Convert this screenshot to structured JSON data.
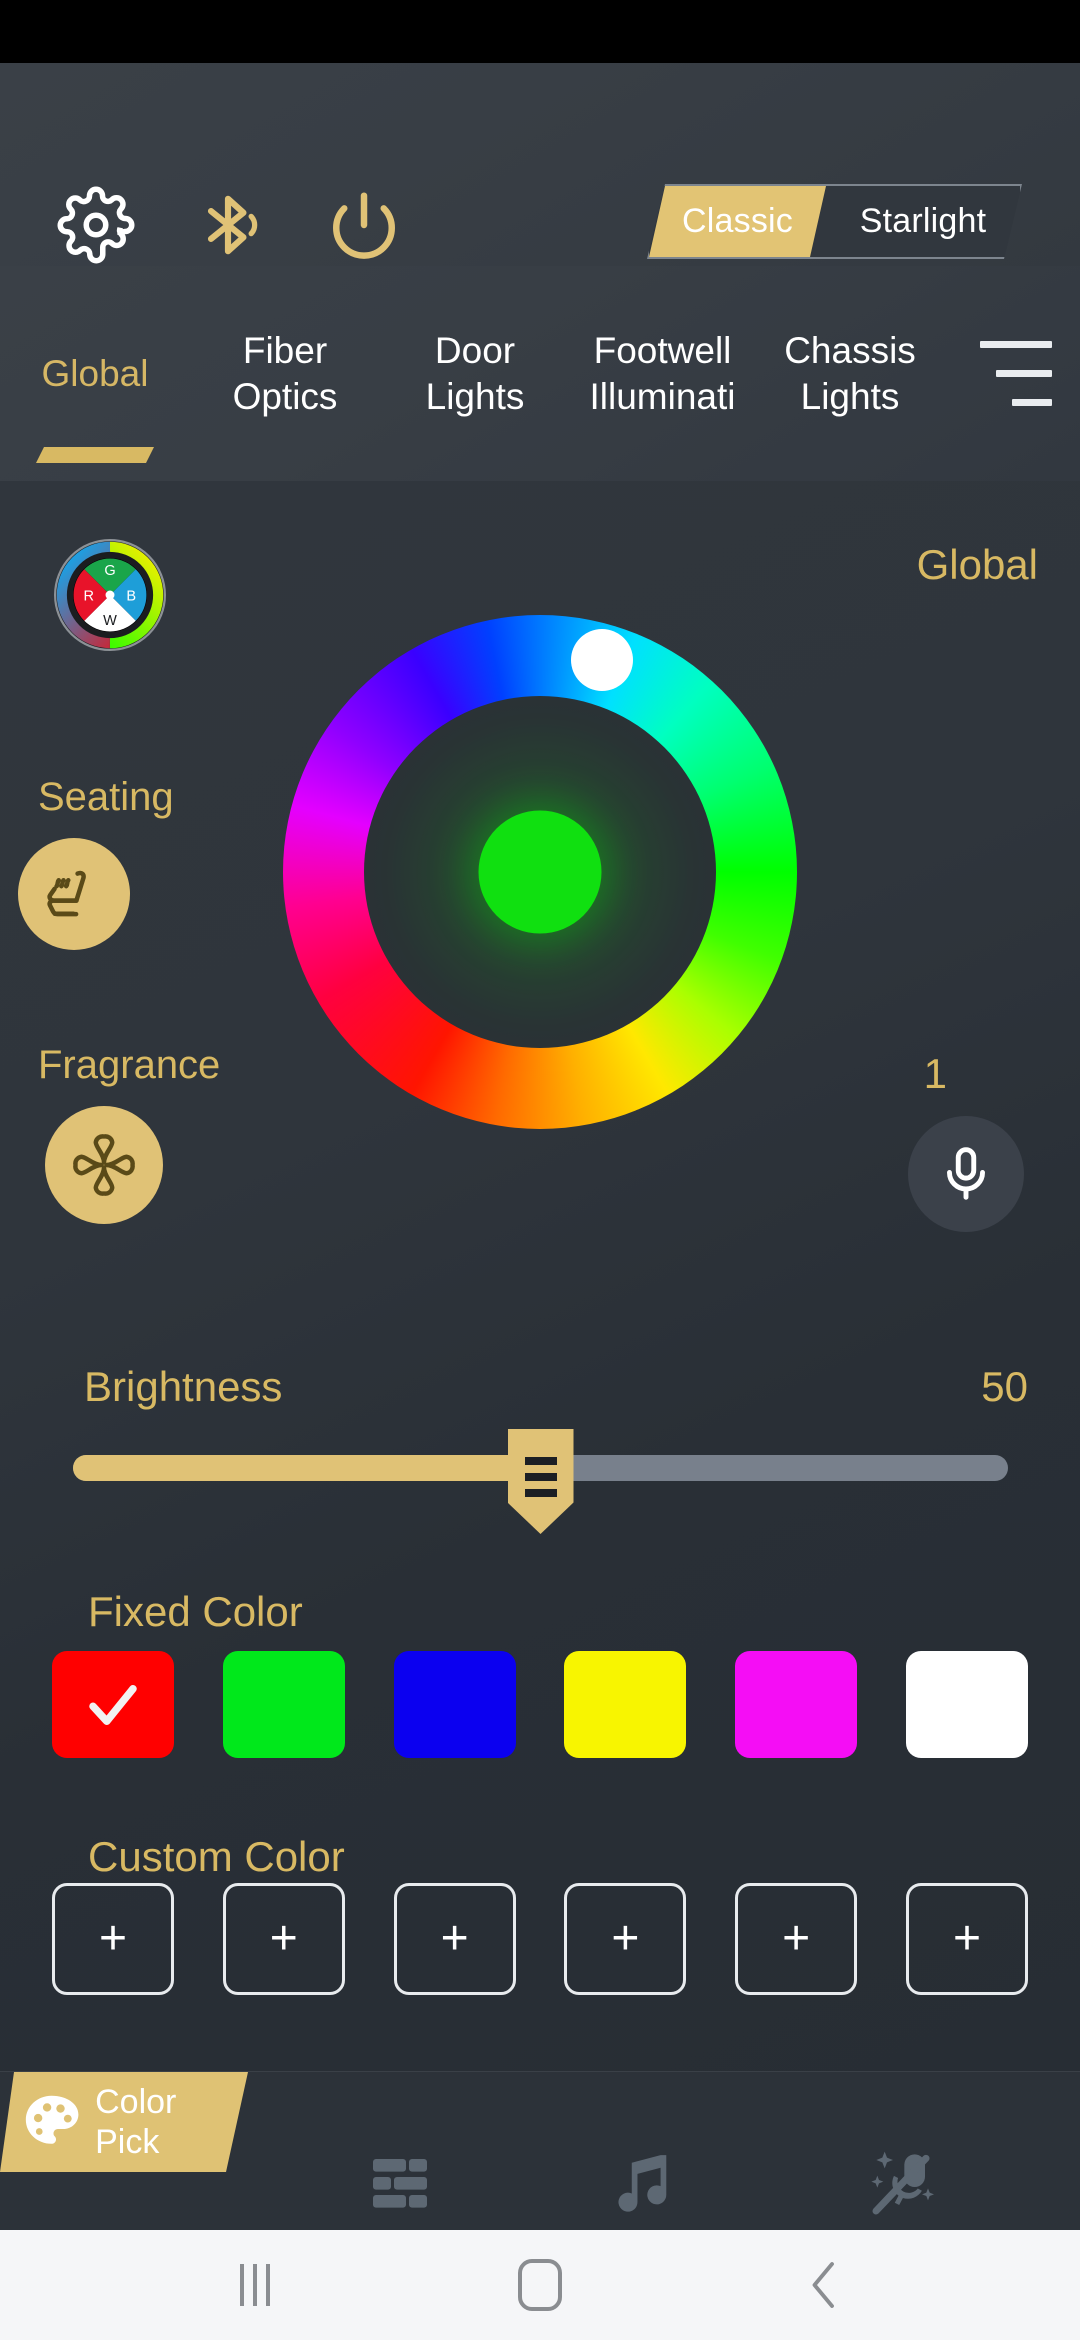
{
  "statusbar": {
    "background": "#000000"
  },
  "toolbar": {
    "icons": [
      {
        "name": "gear-icon",
        "label": "Settings"
      },
      {
        "name": "bluetooth-icon",
        "label": "Bluetooth"
      },
      {
        "name": "power-icon",
        "label": "Power"
      }
    ],
    "mode_toggle": {
      "selected": "Classic",
      "options": [
        "Classic",
        "Starlight"
      ],
      "classic_label": "Classic",
      "starlight_label": "Starlight",
      "active_color": "#e2c474"
    }
  },
  "tabs": {
    "active": "Global",
    "items": [
      {
        "label": "Global",
        "line1": "Global",
        "line2": ""
      },
      {
        "label": "Fiber Optics",
        "line1": "Fiber",
        "line2": "Optics"
      },
      {
        "label": "Door Lights",
        "line1": "Door",
        "line2": "Lights"
      },
      {
        "label": "Footwell Illuminati",
        "line1": "Footwell",
        "line2": "Illuminati"
      },
      {
        "label": "Chassis Lights",
        "line1": "Chassis",
        "line2": "Lights"
      }
    ],
    "menu_icon": "hamburger-menu-icon"
  },
  "content": {
    "zone_label": "Global",
    "rgbw_icon": {
      "name": "rgbw-color-wheel-icon",
      "segments": [
        "R",
        "G",
        "B",
        "W"
      ]
    },
    "color_wheel": {
      "name": "hue-color-wheel",
      "selected_color": "#10e010",
      "handle_position_deg": 80
    },
    "seating": {
      "label": "Seating",
      "icon": "heated-seat-icon",
      "color": "#e0c276"
    },
    "fragrance": {
      "label": "Fragrance",
      "icon": "clover-fragrance-icon",
      "color": "#e0c276"
    },
    "voice": {
      "count": "1",
      "icon": "microphone-icon"
    },
    "brightness": {
      "label": "Brightness",
      "value": "50",
      "percent": 50,
      "min": 0,
      "max": 100
    },
    "fixed_color": {
      "title": "Fixed Color",
      "selected_index": 0,
      "swatches": [
        {
          "name": "red",
          "hex": "#ff0000",
          "selected": true
        },
        {
          "name": "green",
          "hex": "#00e81b",
          "selected": false
        },
        {
          "name": "blue",
          "hex": "#0b00f0",
          "selected": false
        },
        {
          "name": "yellow",
          "hex": "#f8f500",
          "selected": false
        },
        {
          "name": "magenta",
          "hex": "#f50df5",
          "selected": false
        },
        {
          "name": "white",
          "hex": "#ffffff",
          "selected": false
        }
      ]
    },
    "custom_color": {
      "title": "Custom Color",
      "slots": [
        {
          "label": "+",
          "filled": false
        },
        {
          "label": "+",
          "filled": false
        },
        {
          "label": "+",
          "filled": false
        },
        {
          "label": "+",
          "filled": false
        },
        {
          "label": "+",
          "filled": false
        },
        {
          "label": "+",
          "filled": false
        }
      ]
    }
  },
  "bottom_nav": {
    "active": "Color Pick",
    "items": [
      {
        "label": "Color Pick",
        "line1": "Color",
        "line2": "Pick",
        "icon": "palette-icon",
        "active": true
      },
      {
        "label": "",
        "icon": "effects-sliders-icon",
        "active": false
      },
      {
        "label": "",
        "icon": "music-note-icon",
        "active": false
      },
      {
        "label": "",
        "icon": "voice-sparkle-icon",
        "active": false
      }
    ]
  },
  "android_nav": {
    "recents": "recents-icon",
    "home": "home-icon",
    "back": "back-icon"
  },
  "colors": {
    "gold": "#d8b963",
    "gold_fill": "#e0c276",
    "panel": "#2f353c",
    "toolbar": "#383e45"
  }
}
